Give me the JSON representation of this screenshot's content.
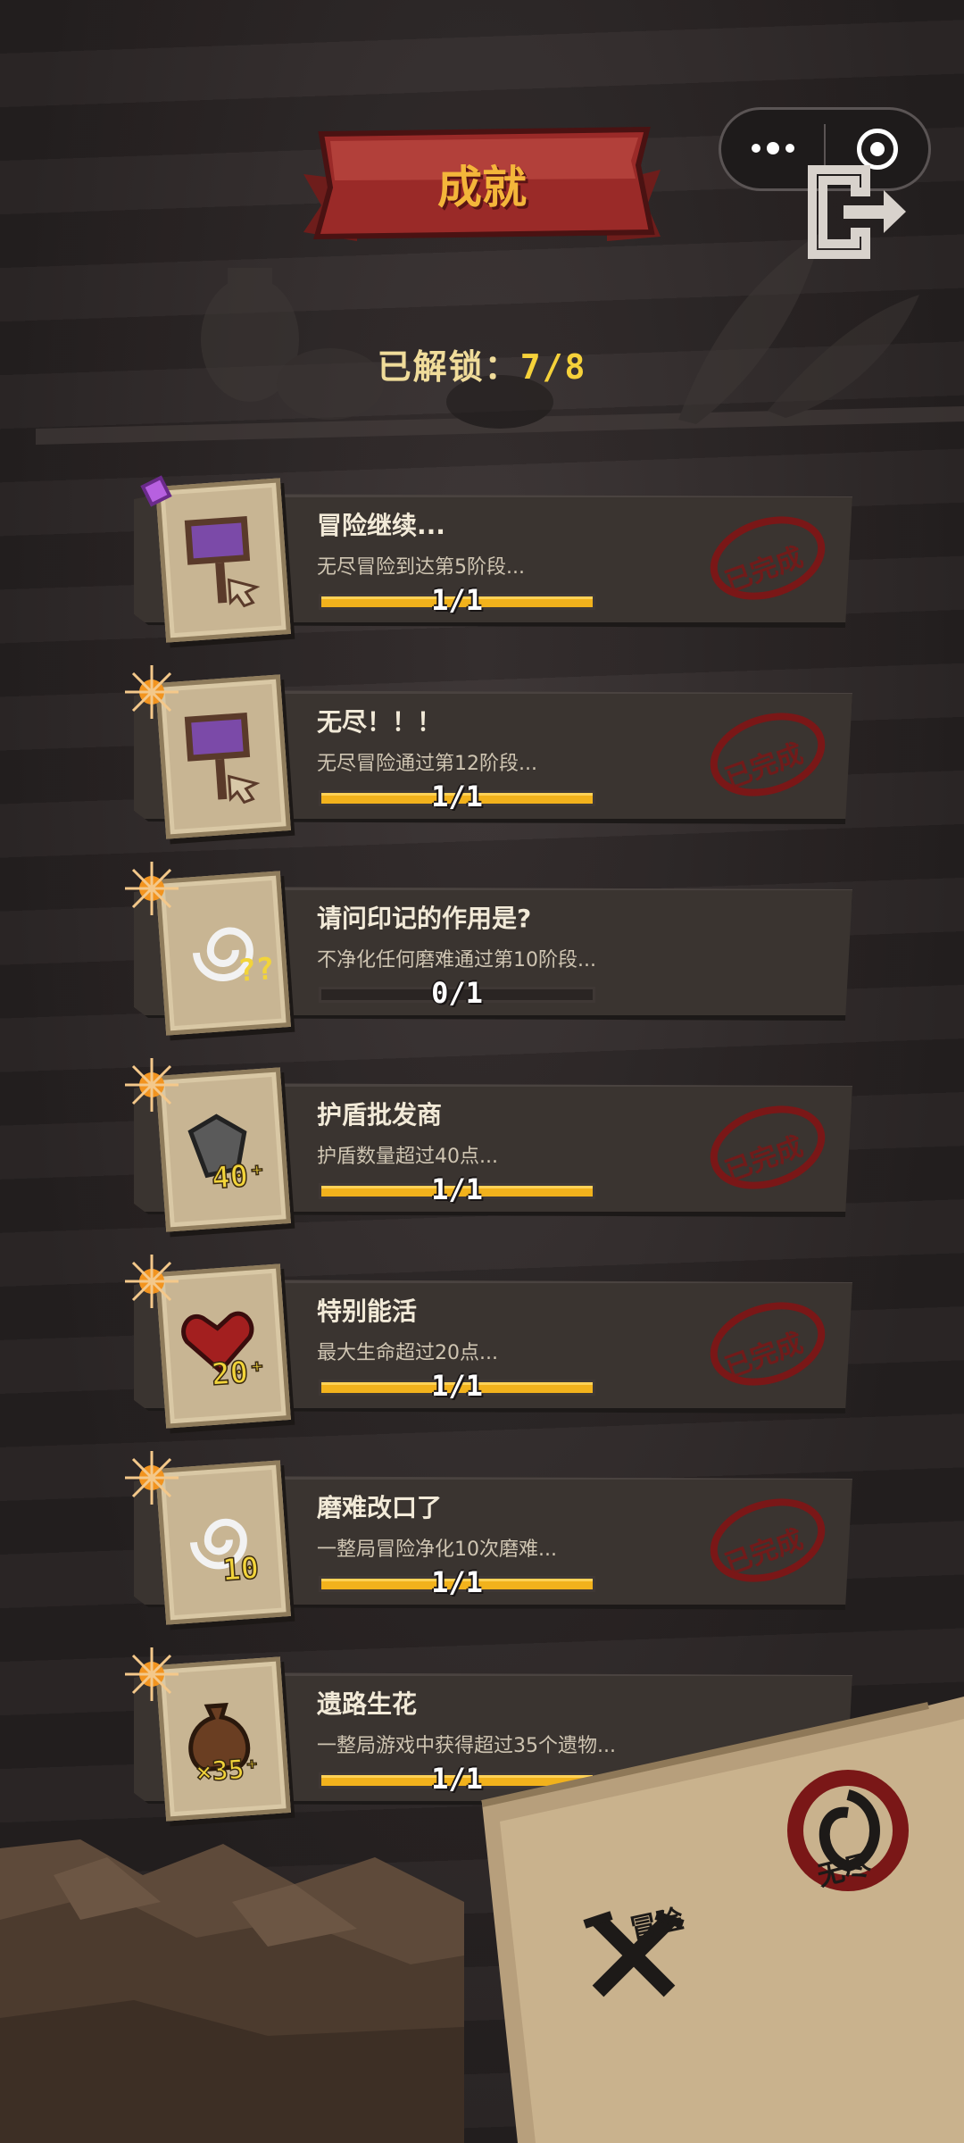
{
  "header": {
    "title": "成就",
    "unlocked_label": "已解锁：",
    "unlocked_value": "7/8"
  },
  "capsule": {
    "menu_icon": "more-dots-icon",
    "close_icon": "target-circle-icon"
  },
  "exit_icon": "exit-door-icon",
  "colors": {
    "accent": "#f2b21c",
    "banner_red": "#9a2a28",
    "stamp_red": "#7a1717",
    "title_gold": "#f4b63a"
  },
  "achievements": [
    {
      "name": "冒险继续...",
      "desc": "无尽冒险到达第5阶段...",
      "progress_text": "1/1",
      "progress": 1.0,
      "completed": true,
      "stamp": "已完成",
      "badge": "gem",
      "icon": "signpost-icon"
    },
    {
      "name": "无尽！！！",
      "desc": "无尽冒险通过第12阶段...",
      "progress_text": "1/1",
      "progress": 1.0,
      "completed": true,
      "stamp": "已完成",
      "badge": "spark",
      "icon": "signpost-icon"
    },
    {
      "name": "请问印记的作用是?",
      "desc": "不净化任何磨难通过第10阶段...",
      "progress_text": "0/1",
      "progress": 0.0,
      "completed": false,
      "stamp": "",
      "badge": "spark",
      "icon": "swirl-question-icon"
    },
    {
      "name": "护盾批发商",
      "desc": "护盾数量超过40点...",
      "progress_text": "1/1",
      "progress": 1.0,
      "completed": true,
      "stamp": "已完成",
      "badge": "spark",
      "icon": "shield-40-icon",
      "icon_text": "40⁺"
    },
    {
      "name": "特别能活",
      "desc": "最大生命超过20点...",
      "progress_text": "1/1",
      "progress": 1.0,
      "completed": true,
      "stamp": "已完成",
      "badge": "spark",
      "icon": "heart-20-icon",
      "icon_text": "20⁺"
    },
    {
      "name": "磨难改口了",
      "desc": "一整局冒险净化10次磨难...",
      "progress_text": "1/1",
      "progress": 1.0,
      "completed": true,
      "stamp": "已完成",
      "badge": "spark",
      "icon": "swirl-10-icon",
      "icon_text": "10"
    },
    {
      "name": "遗路生花",
      "desc": "一整局游戏中获得超过35个遗物...",
      "progress_text": "1/1",
      "progress": 1.0,
      "completed": true,
      "stamp": "",
      "badge": "spark",
      "icon": "bag-35-icon",
      "icon_text": "×35⁺"
    }
  ],
  "bottom_tabs": {
    "adventure_label": "冒险",
    "endless_label": "无尽"
  }
}
